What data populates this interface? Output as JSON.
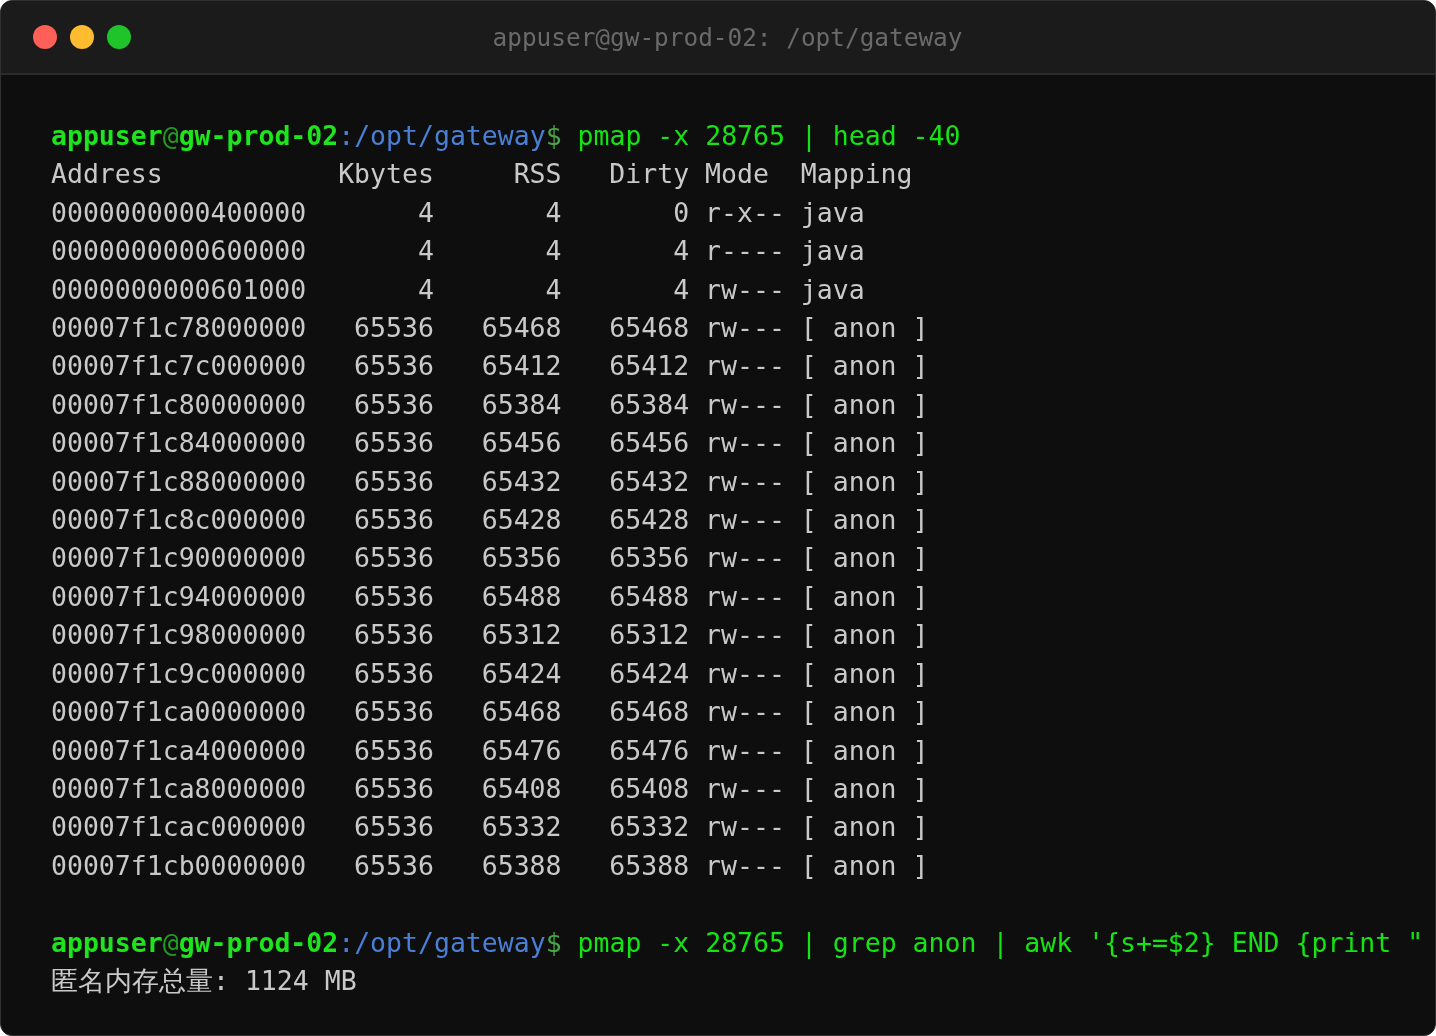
{
  "window": {
    "title": "appuser@gw-prod-02: /opt/gateway"
  },
  "terminal": {
    "lines": [
      {
        "kind": "prompt",
        "user_host": "**appuser**@**gw-prod-02**",
        "path": ":/opt/gateway",
        "symbol": "$",
        "command": "pmap -x 28765 | head -40"
      },
      {
        "kind": "table",
        "columns": [
          "Address",
          "Kbytes",
          "RSS",
          "Dirty",
          "Mode",
          "Mapping"
        ],
        "rows": [
          [
            "0000000000400000",
            "4",
            "4",
            "0",
            "r-x--",
            "java"
          ],
          [
            "0000000000600000",
            "4",
            "4",
            "4",
            "r----",
            "java"
          ],
          [
            "0000000000601000",
            "4",
            "4",
            "4",
            "rw---",
            "java"
          ],
          [
            "00007f1c78000000",
            "65536",
            "65468",
            "65468",
            "rw---",
            "[ anon ]"
          ],
          [
            "00007f1c7c000000",
            "65536",
            "65412",
            "65412",
            "rw---",
            "[ anon ]"
          ],
          [
            "00007f1c80000000",
            "65536",
            "65384",
            "65384",
            "rw---",
            "[ anon ]"
          ],
          [
            "00007f1c84000000",
            "65536",
            "65456",
            "65456",
            "rw---",
            "[ anon ]"
          ],
          [
            "00007f1c88000000",
            "65536",
            "65432",
            "65432",
            "rw---",
            "[ anon ]"
          ],
          [
            "00007f1c8c000000",
            "65536",
            "65428",
            "65428",
            "rw---",
            "[ anon ]"
          ],
          [
            "00007f1c90000000",
            "65536",
            "65356",
            "65356",
            "rw---",
            "[ anon ]"
          ],
          [
            "00007f1c94000000",
            "65536",
            "65488",
            "65488",
            "rw---",
            "[ anon ]"
          ],
          [
            "00007f1c98000000",
            "65536",
            "65312",
            "65312",
            "rw---",
            "[ anon ]"
          ],
          [
            "00007f1c9c000000",
            "65536",
            "65424",
            "65424",
            "rw---",
            "[ anon ]"
          ],
          [
            "00007f1ca0000000",
            "65536",
            "65468",
            "65468",
            "rw---",
            "[ anon ]"
          ],
          [
            "00007f1ca4000000",
            "65536",
            "65476",
            "65476",
            "rw---",
            "[ anon ]"
          ],
          [
            "00007f1ca8000000",
            "65536",
            "65408",
            "65408",
            "rw---",
            "[ anon ]"
          ],
          [
            "00007f1cac000000",
            "65536",
            "65332",
            "65332",
            "rw---",
            "[ anon ]"
          ],
          [
            "00007f1cb0000000",
            "65536",
            "65388",
            "65388",
            "rw---",
            "[ anon ]"
          ]
        ]
      },
      {
        "kind": "prompt",
        "user_host": "**appuser**@**gw-prod-02**",
        "path": ":/opt/gateway",
        "symbol": "$",
        "command": "pmap -x 28765 | grep anon | awk '{s+=$2} END {print \""
      },
      {
        "kind": "output",
        "text": "匿名内存总量: 1124 MB"
      }
    ]
  }
}
